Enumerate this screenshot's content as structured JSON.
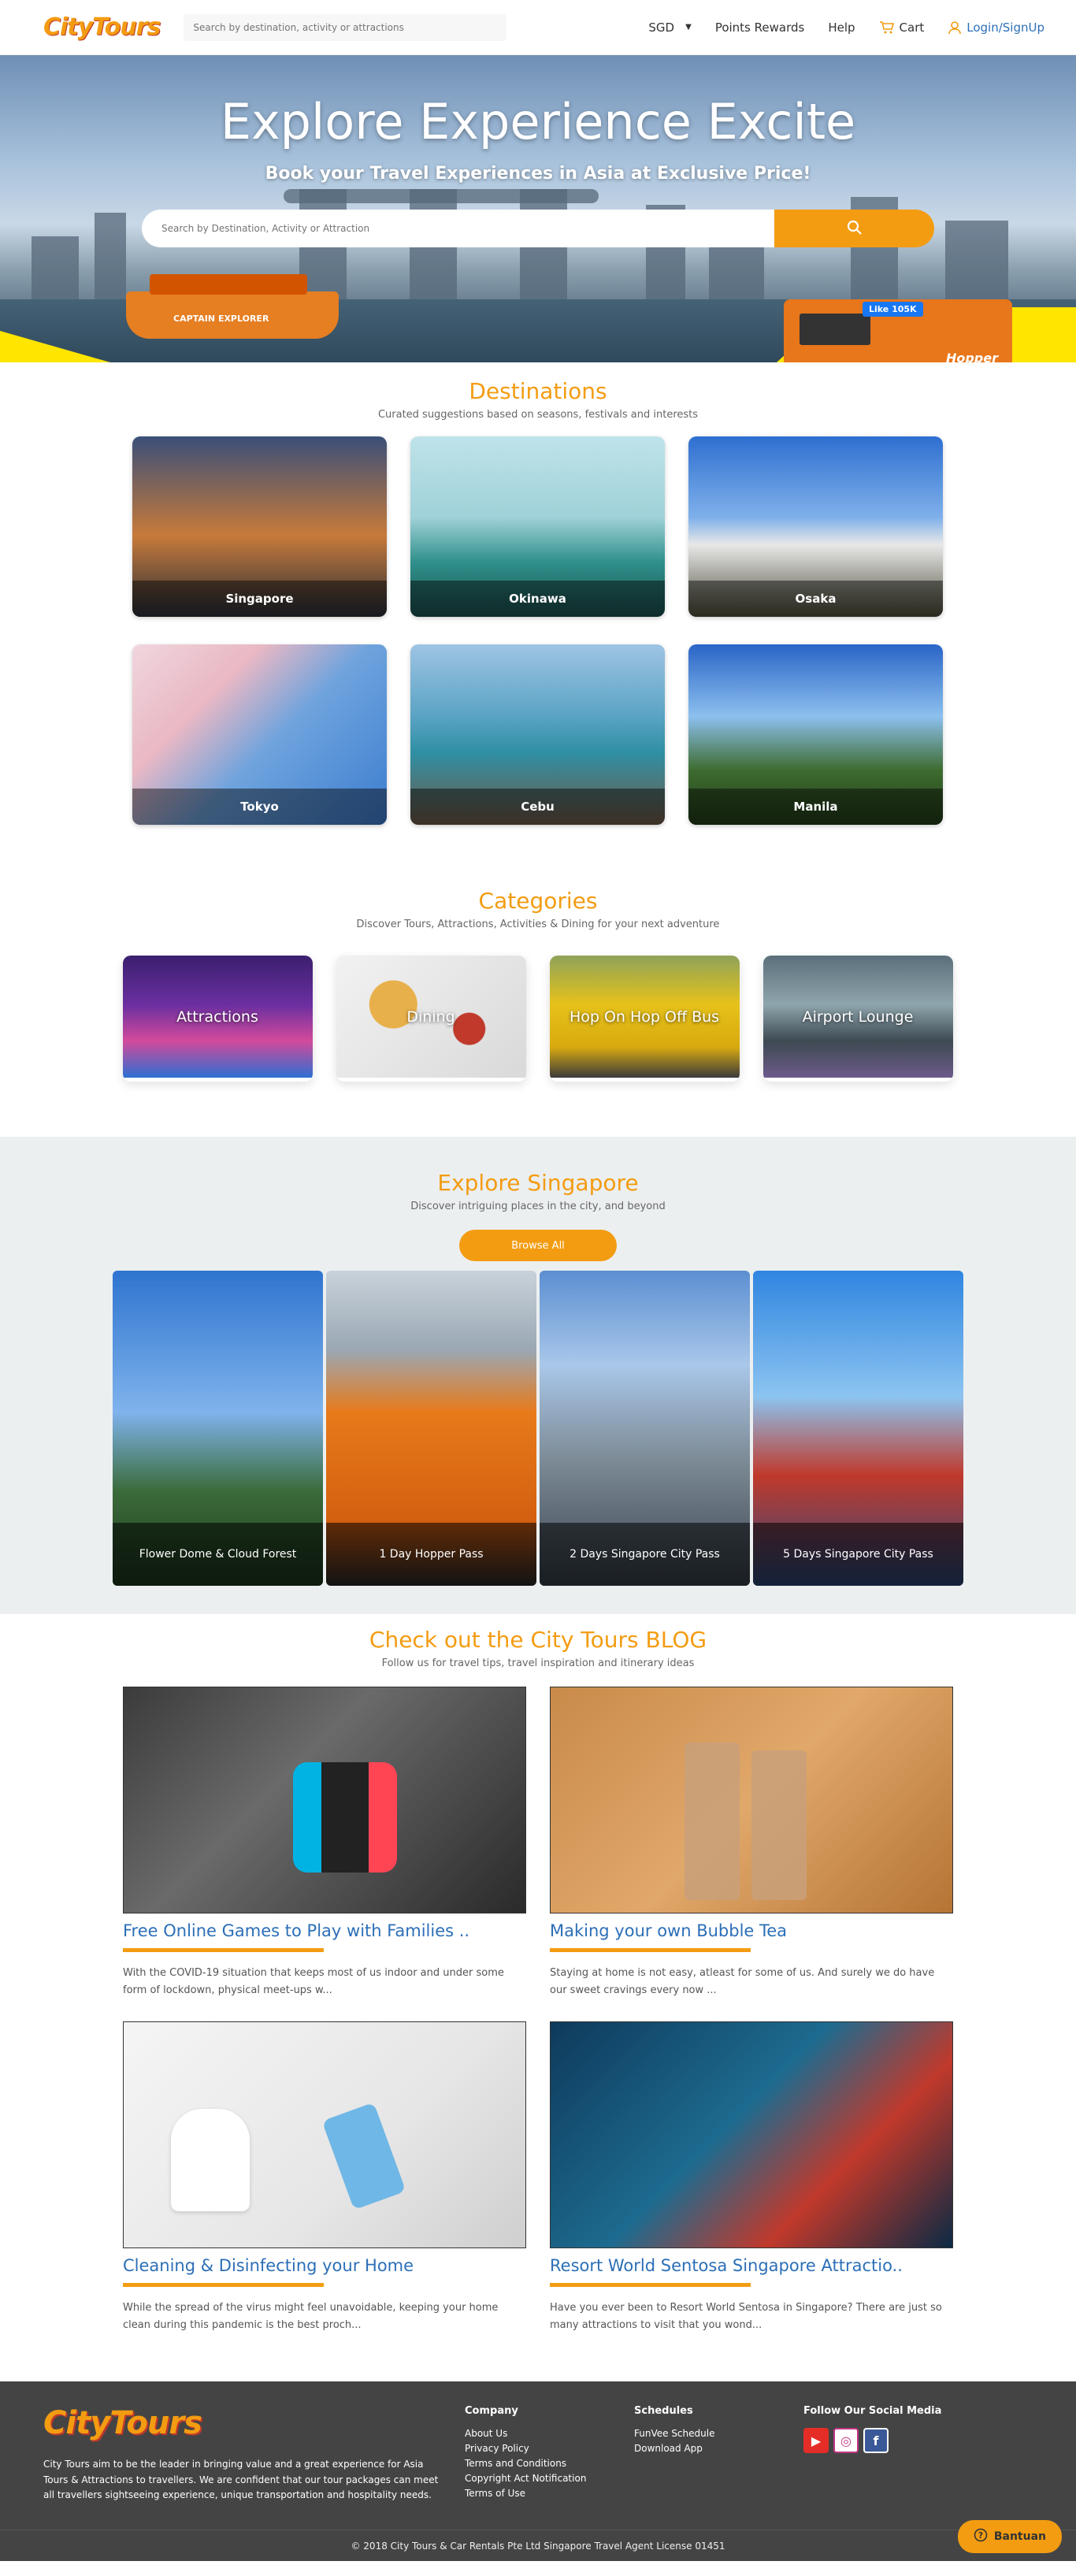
{
  "header": {
    "logo": "CityTours",
    "search_placeholder": "Search by destination, activity or attractions",
    "currency": "SGD",
    "points": "Points Rewards",
    "help": "Help",
    "cart": "Cart",
    "login": "Login/SignUp"
  },
  "hero": {
    "title": "Explore Experience Excite",
    "subtitle": "Book your Travel Experiences in Asia at Exclusive Price!",
    "search_placeholder": "Search by Destination, Activity or Attraction",
    "boat_label": "CAPTAIN EXPLORER",
    "bus_like": "Like 105K",
    "bus_brand": "Hopper"
  },
  "destinations": {
    "title": "Destinations",
    "subtitle": "Curated suggestions based on seasons, festivals and interests",
    "items": [
      "Singapore",
      "Okinawa",
      "Osaka",
      "Tokyo",
      "Cebu",
      "Manila"
    ]
  },
  "categories": {
    "title": "Categories",
    "subtitle": "Discover Tours, Attractions, Activities & Dining for your next adventure",
    "items": [
      "Attractions",
      "Dining",
      "Hop On Hop Off Bus",
      "Airport Lounge"
    ]
  },
  "explore": {
    "title": "Explore Singapore",
    "subtitle": "Discover intriguing places in the city, and beyond",
    "browse": "Browse All",
    "items": [
      "Flower Dome & Cloud Forest",
      "1 Day Hopper Pass",
      "2 Days Singapore City Pass",
      "5 Days Singapore City Pass"
    ]
  },
  "blog": {
    "title": "Check out the City Tours BLOG",
    "subtitle": "Follow us for travel tips, travel inspiration and itinerary ideas",
    "posts": [
      {
        "title": "Free Online Games to Play with Families ..",
        "excerpt": "With the COVID-19 situation that keeps most of us indoor and under some form of lockdown, physical meet-ups w..."
      },
      {
        "title": "Making your own Bubble Tea",
        "excerpt": "Staying at home is not easy, atleast for some of us. And surely we do have our sweet cravings every now ..."
      },
      {
        "title": "Cleaning & Disinfecting your Home",
        "excerpt": "While the spread of the virus might feel unavoidable, keeping your home clean during this pandemic is the best proch..."
      },
      {
        "title": "Resort World Sentosa Singapore Attractio..",
        "excerpt": "Have you ever been to Resort World Sentosa in Singapore? There are just so many attractions to visit that you wond..."
      }
    ]
  },
  "footer": {
    "logo": "CityTours",
    "about": "City Tours aim to be the leader in bringing value and a great experience for Asia Tours & Attractions to travellers. We are confident that our tour packages can meet all travellers sightseeing experience, unique transportation and hospitality needs.",
    "company_title": "Company",
    "company_links": [
      "About Us",
      "Privacy Policy",
      "Terms and Conditions",
      "Copyright Act Notification",
      "Terms of Use"
    ],
    "schedules_title": "Schedules",
    "schedules_links": [
      "FunVee Schedule",
      "Download App"
    ],
    "social_title": "Follow Our Social Media",
    "copyright": "© 2018 City Tours & Car Rentals Pte Ltd Singapore Travel Agent License 01451",
    "help_button": "Bantuan"
  },
  "colors": {
    "accent": "#f39c12",
    "link": "#2c6fb7",
    "footer_bg": "#444444",
    "explore_bg": "#eceff0"
  }
}
